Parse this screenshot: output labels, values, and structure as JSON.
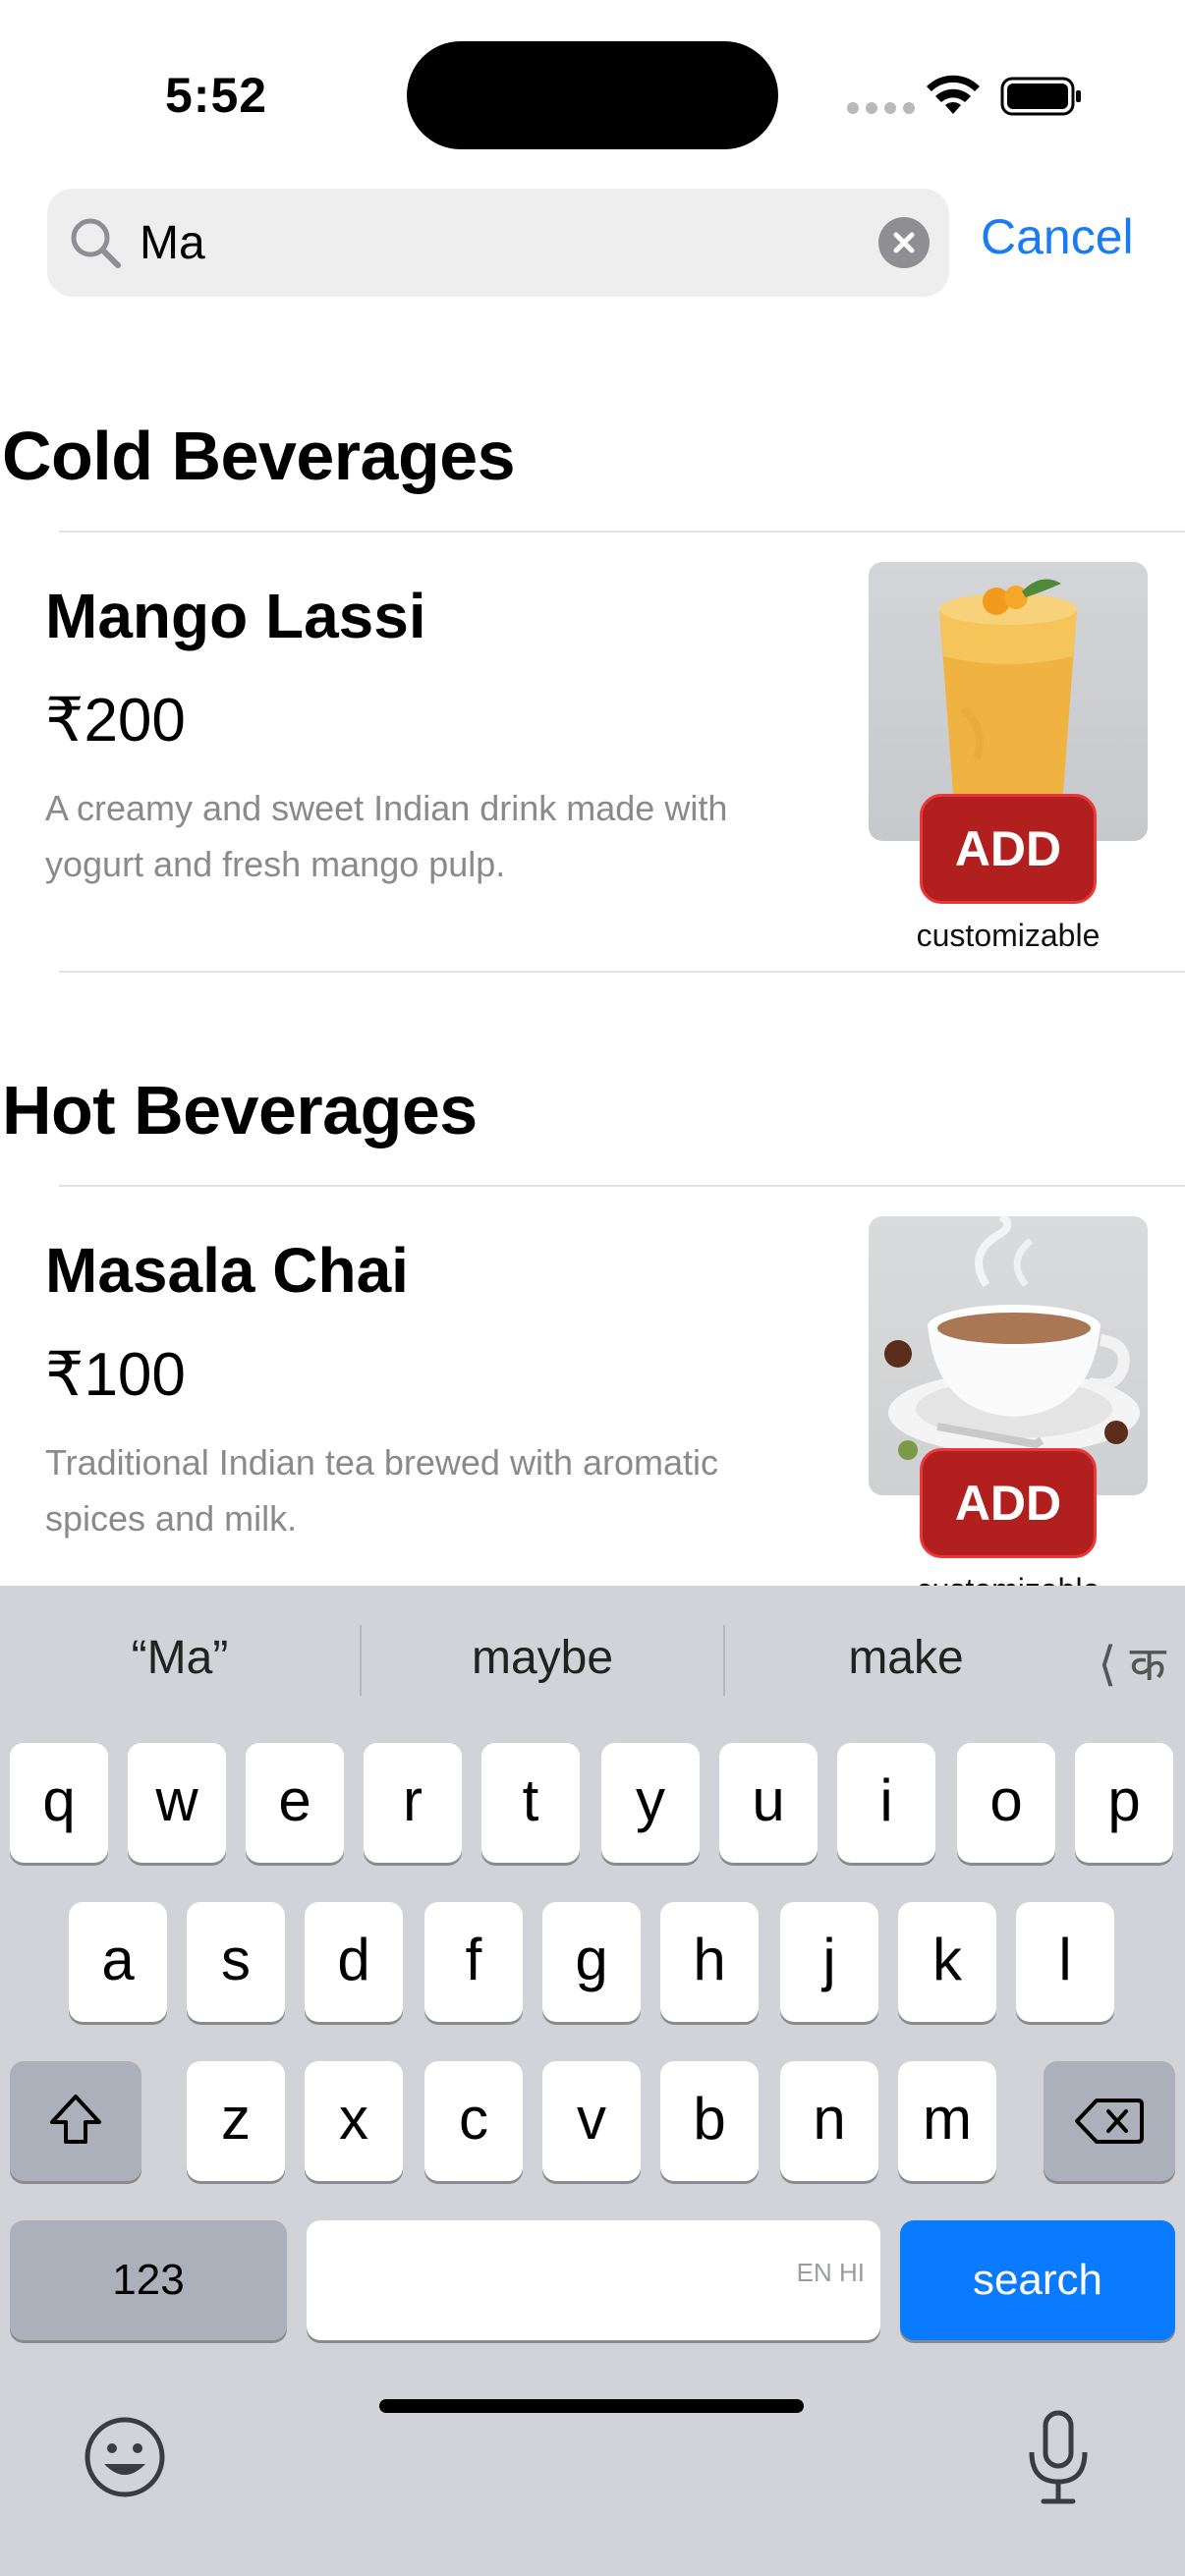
{
  "status_bar": {
    "time": "5:52"
  },
  "search": {
    "value": "Ma",
    "cancel_label": "Cancel"
  },
  "sections": [
    {
      "title": "Cold Beverages",
      "items": [
        {
          "name": "Mango Lassi",
          "price": "₹200",
          "description": "A creamy and sweet Indian drink made with yogurt and fresh mango pulp.",
          "add_label": "ADD",
          "note": "customizable"
        }
      ]
    },
    {
      "title": "Hot Beverages",
      "items": [
        {
          "name": "Masala Chai",
          "price": "₹100",
          "description": "Traditional Indian tea brewed with aromatic spices and milk.",
          "add_label": "ADD",
          "note": "customizable"
        }
      ]
    }
  ],
  "keyboard": {
    "suggestions": [
      "“Ma”",
      "maybe",
      "make"
    ],
    "lang_switch": "⟨ क",
    "row1": [
      "q",
      "w",
      "e",
      "r",
      "t",
      "y",
      "u",
      "i",
      "o",
      "p"
    ],
    "row2": [
      "a",
      "s",
      "d",
      "f",
      "g",
      "h",
      "j",
      "k",
      "l"
    ],
    "row3": [
      "z",
      "x",
      "c",
      "v",
      "b",
      "n",
      "m"
    ],
    "numbers_label": "123",
    "search_label": "search",
    "space_lang_hint": "EN HI"
  },
  "colors": {
    "accent": "#1a7cf5",
    "add_button": "#b21f1f",
    "keyboard_blue": "#0a7aff"
  }
}
